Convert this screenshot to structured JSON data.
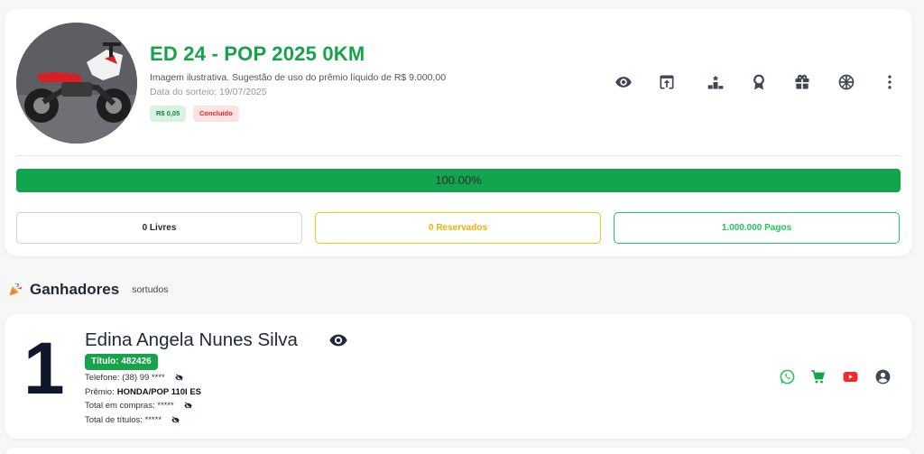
{
  "raffle": {
    "title": "ED 24 - POP 2025 0KM",
    "description": "Imagem ilustrativa. Sugestão de uso do prêmio líquido de R$ 9.000,00",
    "draw_date": "Data do sorteio: 19/07/2025",
    "price_badge": "R$ 0,05",
    "status_badge": "Concluído",
    "progress_label": "100.00%",
    "progress_fraction": 1.0,
    "actions": [
      "eye-icon",
      "share-upload-icon",
      "podium-icon",
      "award-icon",
      "gift-icon",
      "wheel-icon",
      "more-vertical-icon"
    ],
    "counters": {
      "free": "0 Livres",
      "reserved": "0 Reservados",
      "paid": "1.000.000 Pagos"
    }
  },
  "winners_section": {
    "icon": "party-popper-icon",
    "title": "Ganhadores",
    "subtitle": "sortudos"
  },
  "winner": {
    "rank": "1",
    "name": "Edina Angela Nunes Silva",
    "ticket": "Título: 482426",
    "phone_label": "Telefone: (38) 99 ****",
    "prize_label": "Prêmio:",
    "prize_value": "HONDA/POP 110I ES",
    "purchases_label": "Total em compras: *****",
    "titles_label": "Total de títulos: *****",
    "social": [
      "whatsapp-icon",
      "cart-icon",
      "youtube-icon",
      "user-circle-icon"
    ]
  },
  "colors": {
    "brand_green": "#16a34a",
    "progress_green": "#11a64d",
    "reserved_yellow": "#eab308",
    "status_red": "#dc2626",
    "youtube_red": "#ef2a2a"
  }
}
